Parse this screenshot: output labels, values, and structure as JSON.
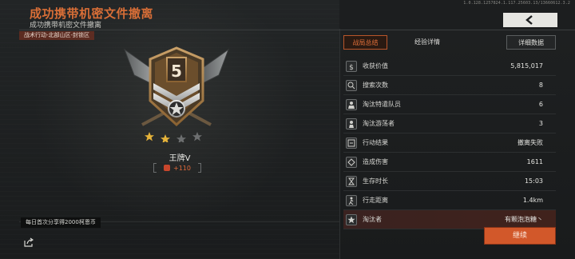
{
  "header": {
    "build_info": "1.0.128.1257824.1.117.25603.13/13660612.3.2",
    "title": "成功携带机密文件撤离",
    "subtitle": "成功携带机密文件撤离",
    "area_tag": "战术行动-北部山区-封锁区",
    "back_icon": "chevron-left-icon"
  },
  "player": {
    "rank_number": "5",
    "name": "王牌V",
    "exp_gain": "+110",
    "stars_filled": 2,
    "stars_total": 4
  },
  "share": {
    "tip": "每日首次分享得2000柯恩币",
    "icon": "share-icon"
  },
  "tabs": {
    "summary": "战局总结",
    "experience": "经验详情",
    "detail": "详细数据"
  },
  "stats": [
    {
      "icon": "dollar-icon",
      "label": "收获价值",
      "value": "5,815,017"
    },
    {
      "icon": "search-icon",
      "label": "搜索次数",
      "value": "8"
    },
    {
      "icon": "soldier-icon",
      "label": "淘汰特遣队员",
      "value": "6"
    },
    {
      "icon": "wanderer-icon",
      "label": "淘汰游荡者",
      "value": "3"
    },
    {
      "icon": "action-icon",
      "label": "行动结果",
      "value": "撤离失败"
    },
    {
      "icon": "damage-icon",
      "label": "造成伤害",
      "value": "1611"
    },
    {
      "icon": "hourglass-icon",
      "label": "生存时长",
      "value": "15:03"
    },
    {
      "icon": "walk-icon",
      "label": "行走距离",
      "value": "1.4km"
    },
    {
      "icon": "star-icon",
      "label": "淘汰者",
      "value": "有颗泡泡糖丶"
    }
  ],
  "buttons": {
    "continue": "继续"
  },
  "colors": {
    "accent": "#d86e37",
    "button": "#d2582a"
  }
}
